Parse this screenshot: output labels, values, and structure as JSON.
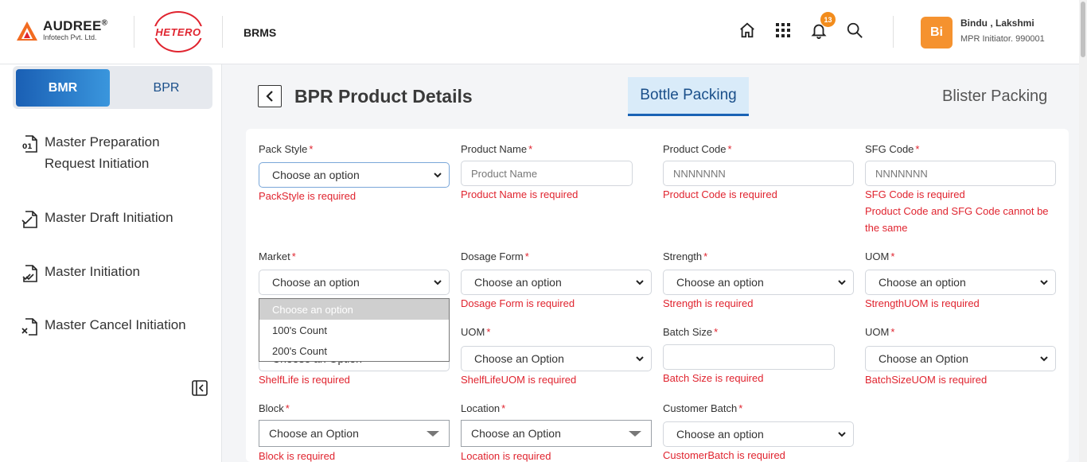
{
  "header": {
    "brand_name": "AUDREE",
    "brand_sub": "Infotech Pvt. Ltd.",
    "partner_logo": "HETERO",
    "app_name": "BRMS",
    "notification_count": "13",
    "avatar_initials": "Bi",
    "user_name": "Bindu , Lakshmi",
    "user_role": "MPR Initiator. 990001",
    "icons": [
      "home-icon",
      "apps-grid-icon",
      "bell-icon",
      "search-icon"
    ]
  },
  "sidebar": {
    "toggle": {
      "bmr": "BMR",
      "bpr": "BPR",
      "active": "BMR"
    },
    "items": [
      {
        "label": "Master Preparation Request Initiation",
        "icon": "document-01-icon"
      },
      {
        "label": "Master Draft Initiation",
        "icon": "document-draft-icon"
      },
      {
        "label": "Master Initiation",
        "icon": "document-check-icon"
      },
      {
        "label": "Master Cancel Initiation",
        "icon": "document-cancel-icon"
      }
    ]
  },
  "main": {
    "title": "BPR Product Details",
    "tabs": {
      "bottle": "Bottle Packing",
      "blister": "Blister Packing",
      "active": "Bottle Packing"
    },
    "form": {
      "pack_style": {
        "label": "Pack Style",
        "value": "Choose an option",
        "error": "PackStyle is required"
      },
      "product_name": {
        "label": "Product Name",
        "placeholder": "Product Name",
        "error": "Product Name is required"
      },
      "product_code": {
        "label": "Product Code",
        "placeholder": "NNNNNNN",
        "error": "Product Code is required"
      },
      "sfg_code": {
        "label": "SFG Code",
        "placeholder": "NNNNNNN",
        "error": "SFG Code is required",
        "error2": "Product Code and SFG Code cannot be the same"
      },
      "market": {
        "label": "Market",
        "value": "Choose an option",
        "options": [
          "Choose an option",
          "100's Count",
          "200's Count"
        ]
      },
      "dosage_form": {
        "label": "Dosage Form",
        "value": "Choose an option",
        "error": "Dosage Form is required"
      },
      "strength": {
        "label": "Strength",
        "value": "Choose an option",
        "error": "Strength is required"
      },
      "strength_uom": {
        "label": "UOM",
        "value": "Choose an option",
        "error": "StrengthUOM is required"
      },
      "shelf_life": {
        "value": "Choose an Option",
        "error": "ShelfLife is required"
      },
      "shelf_life_uom": {
        "label": "UOM",
        "value": "Choose an Option",
        "error": "ShelfLifeUOM is required"
      },
      "batch_size": {
        "label": "Batch Size",
        "value": "",
        "error": "Batch Size is required"
      },
      "batch_size_uom": {
        "label": "UOM",
        "value": "Choose an Option",
        "error": "BatchSizeUOM is required"
      },
      "block": {
        "label": "Block",
        "value": "Choose an Option",
        "error": "Block is required"
      },
      "location": {
        "label": "Location",
        "value": "Choose an Option",
        "error": "Location is required"
      },
      "customer_batch": {
        "label": "Customer Batch",
        "value": "Choose an option",
        "error": "CustomerBatch is required"
      }
    }
  },
  "colors": {
    "accent": "#1a63b5",
    "error": "#e0242f",
    "badge": "#f28c1c",
    "avatar": "#f5922f"
  }
}
